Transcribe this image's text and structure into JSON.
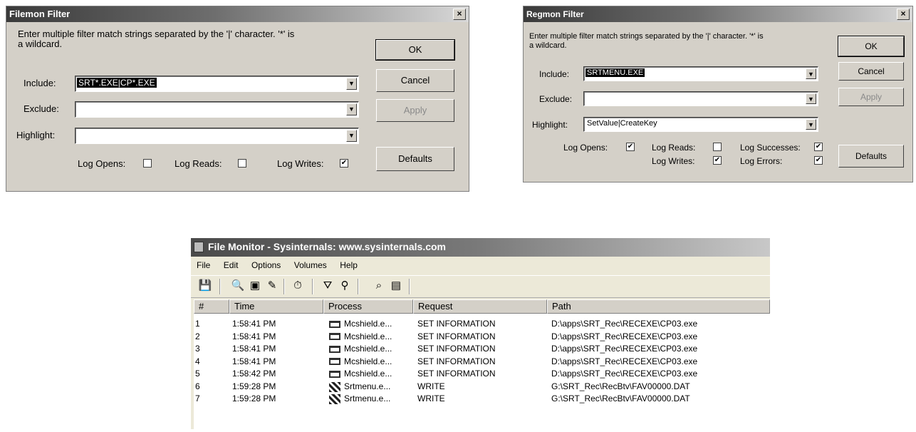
{
  "filemon_filter": {
    "title": "Filemon Filter",
    "close": "×",
    "prompt_line1": "Enter multiple filter match strings separated by the '|' character. '*' is",
    "prompt_line2": "a wildcard.",
    "include_label": "Include:",
    "include_value": "SRT*.EXE|CP*.EXE",
    "exclude_label": "Exclude:",
    "exclude_value": "",
    "highlight_label": "Highlight:",
    "highlight_value": "",
    "log_opens_label": "Log Opens:",
    "log_opens_checked": false,
    "log_reads_label": "Log Reads:",
    "log_reads_checked": false,
    "log_writes_label": "Log Writes:",
    "log_writes_checked": true,
    "ok_label": "OK",
    "cancel_label": "Cancel",
    "apply_label": "Apply",
    "defaults_label": "Defaults"
  },
  "regmon_filter": {
    "title": "Regmon Filter",
    "close": "×",
    "prompt_line1": "Enter multiple filter match strings separated by the '|' character. '*' is",
    "prompt_line2": "a wildcard.",
    "include_label": "Include:",
    "include_value": "SRTMENU.EXE",
    "exclude_label": "Exclude:",
    "exclude_value": "",
    "highlight_label": "Highlight:",
    "highlight_value": "SetValue|CreateKey",
    "log_opens_label": "Log Opens:",
    "log_opens_checked": true,
    "log_reads_label": "Log Reads:",
    "log_reads_checked": false,
    "log_successes_label": "Log Successes:",
    "log_successes_checked": true,
    "log_writes_label": "Log Writes:",
    "log_writes_checked": true,
    "log_errors_label": "Log Errors:",
    "log_errors_checked": true,
    "ok_label": "OK",
    "cancel_label": "Cancel",
    "apply_label": "Apply",
    "defaults_label": "Defaults"
  },
  "file_monitor": {
    "title": "File Monitor - Sysinternals: www.sysinternals.com",
    "menu": [
      "File",
      "Edit",
      "Options",
      "Volumes",
      "Help"
    ],
    "toolbar_icons": [
      "save-icon",
      "magnify-icon",
      "capture-icon",
      "edit-filter-icon",
      "clock-icon",
      "filter-icon",
      "highlight-icon",
      "find-icon",
      "jump-icon"
    ],
    "columns": [
      "#",
      "Time",
      "Process",
      "Request",
      "Path"
    ],
    "rows": [
      {
        "num": "1",
        "time": "1:58:41 PM",
        "process": "Mcshield.e...",
        "request": "SET INFORMATION",
        "path": "D:\\apps\\SRT_Rec\\RECEXE\\CP03.exe",
        "icon": "window-icon"
      },
      {
        "num": "2",
        "time": "1:58:41 PM",
        "process": "Mcshield.e...",
        "request": "SET INFORMATION",
        "path": "D:\\apps\\SRT_Rec\\RECEXE\\CP03.exe",
        "icon": "window-icon"
      },
      {
        "num": "3",
        "time": "1:58:41 PM",
        "process": "Mcshield.e...",
        "request": "SET INFORMATION",
        "path": "D:\\apps\\SRT_Rec\\RECEXE\\CP03.exe",
        "icon": "window-icon"
      },
      {
        "num": "4",
        "time": "1:58:41 PM",
        "process": "Mcshield.e...",
        "request": "SET INFORMATION",
        "path": "D:\\apps\\SRT_Rec\\RECEXE\\CP03.exe",
        "icon": "window-icon"
      },
      {
        "num": "5",
        "time": "1:58:42 PM",
        "process": "Mcshield.e...",
        "request": "SET INFORMATION",
        "path": "D:\\apps\\SRT_Rec\\RECEXE\\CP03.exe",
        "icon": "window-icon"
      },
      {
        "num": "6",
        "time": "1:59:28 PM",
        "process": "Srtmenu.e...",
        "request": "WRITE",
        "path": "G:\\SRT_Rec\\RecBtv\\FAV00000.DAT",
        "icon": "srtmenu-icon"
      },
      {
        "num": "7",
        "time": "1:59:28 PM",
        "process": "Srtmenu.e...",
        "request": "WRITE",
        "path": "G:\\SRT_Rec\\RecBtv\\FAV00000.DAT",
        "icon": "srtmenu-icon"
      }
    ]
  }
}
